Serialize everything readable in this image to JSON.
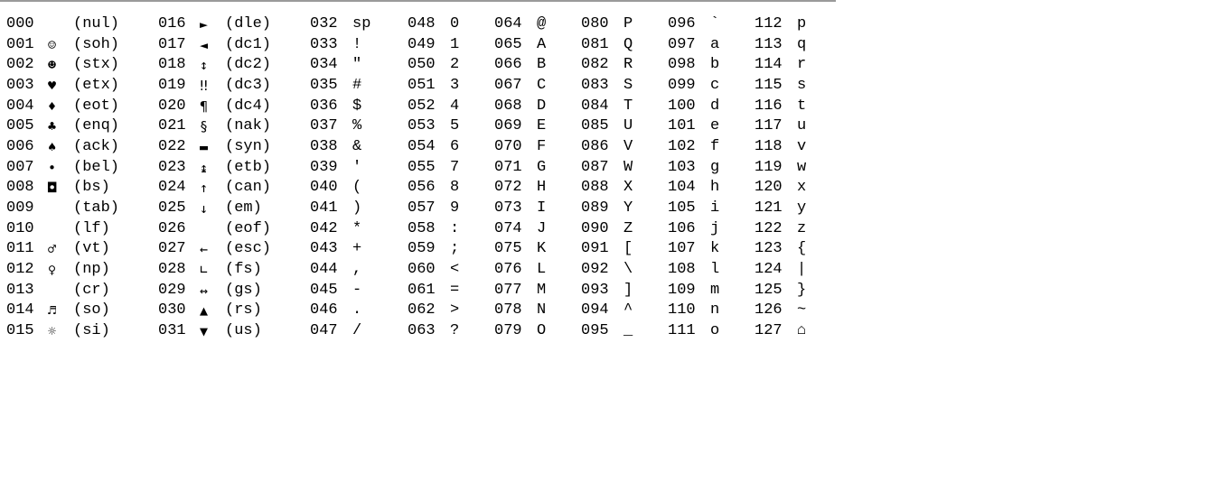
{
  "columns": [
    {
      "kind": "control",
      "rows": [
        {
          "code": "000",
          "glyph": "",
          "abbr": "(nul)"
        },
        {
          "code": "001",
          "glyph": "☺",
          "abbr": "(soh)"
        },
        {
          "code": "002",
          "glyph": "☻",
          "abbr": "(stx)"
        },
        {
          "code": "003",
          "glyph": "♥",
          "abbr": "(etx)"
        },
        {
          "code": "004",
          "glyph": "♦",
          "abbr": "(eot)"
        },
        {
          "code": "005",
          "glyph": "♣",
          "abbr": "(enq)"
        },
        {
          "code": "006",
          "glyph": "♠",
          "abbr": "(ack)"
        },
        {
          "code": "007",
          "glyph": "•",
          "abbr": "(bel)"
        },
        {
          "code": "008",
          "glyph": "◘",
          "abbr": "(bs)"
        },
        {
          "code": "009",
          "glyph": "",
          "abbr": "(tab)"
        },
        {
          "code": "010",
          "glyph": "",
          "abbr": "(lf)"
        },
        {
          "code": "011",
          "glyph": "♂",
          "abbr": "(vt)"
        },
        {
          "code": "012",
          "glyph": "♀",
          "abbr": "(np)"
        },
        {
          "code": "013",
          "glyph": "",
          "abbr": "(cr)"
        },
        {
          "code": "014",
          "glyph": "♬",
          "abbr": "(so)"
        },
        {
          "code": "015",
          "glyph": "☼",
          "abbr": "(si)"
        }
      ]
    },
    {
      "kind": "control",
      "rows": [
        {
          "code": "016",
          "glyph": "►",
          "abbr": "(dle)"
        },
        {
          "code": "017",
          "glyph": "◄",
          "abbr": "(dc1)"
        },
        {
          "code": "018",
          "glyph": "↕",
          "abbr": "(dc2)"
        },
        {
          "code": "019",
          "glyph": "‼",
          "abbr": "(dc3)"
        },
        {
          "code": "020",
          "glyph": "¶",
          "abbr": "(dc4)"
        },
        {
          "code": "021",
          "glyph": "§",
          "abbr": "(nak)"
        },
        {
          "code": "022",
          "glyph": "▬",
          "abbr": "(syn)"
        },
        {
          "code": "023",
          "glyph": "↨",
          "abbr": "(etb)"
        },
        {
          "code": "024",
          "glyph": "↑",
          "abbr": "(can)"
        },
        {
          "code": "025",
          "glyph": "↓",
          "abbr": "(em)"
        },
        {
          "code": "026",
          "glyph": "",
          "abbr": "(eof)"
        },
        {
          "code": "027",
          "glyph": "←",
          "abbr": "(esc)"
        },
        {
          "code": "028",
          "glyph": "∟",
          "abbr": "(fs)"
        },
        {
          "code": "029",
          "glyph": "↔",
          "abbr": "(gs)"
        },
        {
          "code": "030",
          "glyph": "▲",
          "abbr": "(rs)"
        },
        {
          "code": "031",
          "glyph": "▼",
          "abbr": "(us)"
        }
      ]
    },
    {
      "kind": "printable",
      "rows": [
        {
          "code": "032",
          "glyph": "sp"
        },
        {
          "code": "033",
          "glyph": "!"
        },
        {
          "code": "034",
          "glyph": "\""
        },
        {
          "code": "035",
          "glyph": "#"
        },
        {
          "code": "036",
          "glyph": "$"
        },
        {
          "code": "037",
          "glyph": "%"
        },
        {
          "code": "038",
          "glyph": "&"
        },
        {
          "code": "039",
          "glyph": "'"
        },
        {
          "code": "040",
          "glyph": "("
        },
        {
          "code": "041",
          "glyph": ")"
        },
        {
          "code": "042",
          "glyph": "*"
        },
        {
          "code": "043",
          "glyph": "+"
        },
        {
          "code": "044",
          "glyph": ","
        },
        {
          "code": "045",
          "glyph": "-"
        },
        {
          "code": "046",
          "glyph": "."
        },
        {
          "code": "047",
          "glyph": "/"
        }
      ]
    },
    {
      "kind": "printable",
      "rows": [
        {
          "code": "048",
          "glyph": "0"
        },
        {
          "code": "049",
          "glyph": "1"
        },
        {
          "code": "050",
          "glyph": "2"
        },
        {
          "code": "051",
          "glyph": "3"
        },
        {
          "code": "052",
          "glyph": "4"
        },
        {
          "code": "053",
          "glyph": "5"
        },
        {
          "code": "054",
          "glyph": "6"
        },
        {
          "code": "055",
          "glyph": "7"
        },
        {
          "code": "056",
          "glyph": "8"
        },
        {
          "code": "057",
          "glyph": "9"
        },
        {
          "code": "058",
          "glyph": ":"
        },
        {
          "code": "059",
          "glyph": ";"
        },
        {
          "code": "060",
          "glyph": "<"
        },
        {
          "code": "061",
          "glyph": "="
        },
        {
          "code": "062",
          "glyph": ">"
        },
        {
          "code": "063",
          "glyph": "?"
        }
      ]
    },
    {
      "kind": "printable",
      "rows": [
        {
          "code": "064",
          "glyph": "@"
        },
        {
          "code": "065",
          "glyph": "A"
        },
        {
          "code": "066",
          "glyph": "B"
        },
        {
          "code": "067",
          "glyph": "C"
        },
        {
          "code": "068",
          "glyph": "D"
        },
        {
          "code": "069",
          "glyph": "E"
        },
        {
          "code": "070",
          "glyph": "F"
        },
        {
          "code": "071",
          "glyph": "G"
        },
        {
          "code": "072",
          "glyph": "H"
        },
        {
          "code": "073",
          "glyph": "I"
        },
        {
          "code": "074",
          "glyph": "J"
        },
        {
          "code": "075",
          "glyph": "K"
        },
        {
          "code": "076",
          "glyph": "L"
        },
        {
          "code": "077",
          "glyph": "M"
        },
        {
          "code": "078",
          "glyph": "N"
        },
        {
          "code": "079",
          "glyph": "O"
        }
      ]
    },
    {
      "kind": "printable",
      "rows": [
        {
          "code": "080",
          "glyph": "P"
        },
        {
          "code": "081",
          "glyph": "Q"
        },
        {
          "code": "082",
          "glyph": "R"
        },
        {
          "code": "083",
          "glyph": "S"
        },
        {
          "code": "084",
          "glyph": "T"
        },
        {
          "code": "085",
          "glyph": "U"
        },
        {
          "code": "086",
          "glyph": "V"
        },
        {
          "code": "087",
          "glyph": "W"
        },
        {
          "code": "088",
          "glyph": "X"
        },
        {
          "code": "089",
          "glyph": "Y"
        },
        {
          "code": "090",
          "glyph": "Z"
        },
        {
          "code": "091",
          "glyph": "["
        },
        {
          "code": "092",
          "glyph": "\\"
        },
        {
          "code": "093",
          "glyph": "]"
        },
        {
          "code": "094",
          "glyph": "^"
        },
        {
          "code": "095",
          "glyph": "_"
        }
      ]
    },
    {
      "kind": "printable",
      "rows": [
        {
          "code": "096",
          "glyph": "`"
        },
        {
          "code": "097",
          "glyph": "a"
        },
        {
          "code": "098",
          "glyph": "b"
        },
        {
          "code": "099",
          "glyph": "c"
        },
        {
          "code": "100",
          "glyph": "d"
        },
        {
          "code": "101",
          "glyph": "e"
        },
        {
          "code": "102",
          "glyph": "f"
        },
        {
          "code": "103",
          "glyph": "g"
        },
        {
          "code": "104",
          "glyph": "h"
        },
        {
          "code": "105",
          "glyph": "i"
        },
        {
          "code": "106",
          "glyph": "j"
        },
        {
          "code": "107",
          "glyph": "k"
        },
        {
          "code": "108",
          "glyph": "l"
        },
        {
          "code": "109",
          "glyph": "m"
        },
        {
          "code": "110",
          "glyph": "n"
        },
        {
          "code": "111",
          "glyph": "o"
        }
      ]
    },
    {
      "kind": "printable",
      "rows": [
        {
          "code": "112",
          "glyph": "p"
        },
        {
          "code": "113",
          "glyph": "q"
        },
        {
          "code": "114",
          "glyph": "r"
        },
        {
          "code": "115",
          "glyph": "s"
        },
        {
          "code": "116",
          "glyph": "t"
        },
        {
          "code": "117",
          "glyph": "u"
        },
        {
          "code": "118",
          "glyph": "v"
        },
        {
          "code": "119",
          "glyph": "w"
        },
        {
          "code": "120",
          "glyph": "x"
        },
        {
          "code": "121",
          "glyph": "y"
        },
        {
          "code": "122",
          "glyph": "z"
        },
        {
          "code": "123",
          "glyph": "{"
        },
        {
          "code": "124",
          "glyph": "|"
        },
        {
          "code": "125",
          "glyph": "}"
        },
        {
          "code": "126",
          "glyph": "~"
        },
        {
          "code": "127",
          "glyph": "⌂"
        }
      ]
    }
  ]
}
